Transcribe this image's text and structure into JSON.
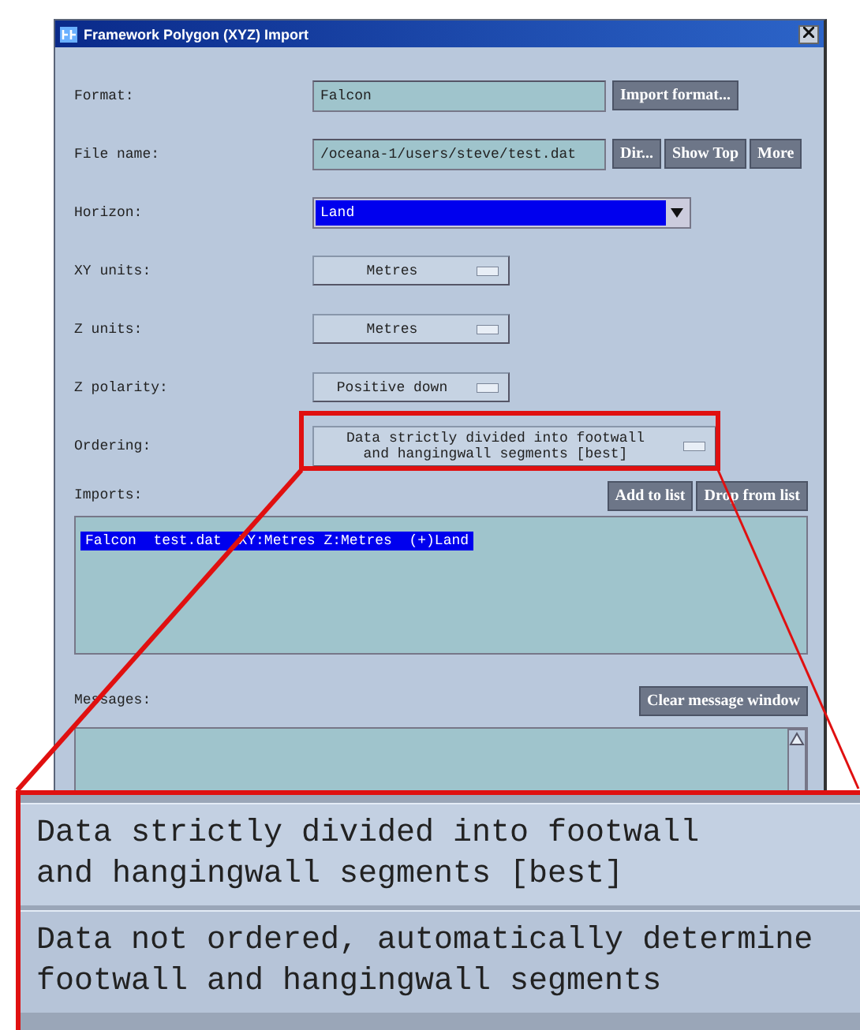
{
  "window": {
    "title": "Framework Polygon (XYZ) Import"
  },
  "fields": [
    {
      "kind": "text",
      "label": "Format:",
      "value": "Falcon",
      "buttons": [
        "Import format..."
      ]
    },
    {
      "kind": "text",
      "label": "File name:",
      "value": "/oceana-1/users/steve/test.dat",
      "buttons": [
        "Dir...",
        "Show Top",
        "More"
      ]
    },
    {
      "kind": "combo",
      "label": "Horizon:",
      "value": "Land"
    },
    {
      "kind": "option",
      "label": "XY units:",
      "value": "Metres"
    },
    {
      "kind": "option",
      "label": "Z units:",
      "value": "Metres"
    },
    {
      "kind": "option",
      "label": "Z polarity:",
      "value": "Positive down"
    },
    {
      "kind": "option",
      "label": "Ordering:",
      "value": "Data strictly divided into footwall\nand hangingwall segments [best]",
      "highlighted": true
    }
  ],
  "imports": {
    "label": "Imports:",
    "buttons": [
      "Add to list",
      "Drop from list"
    ],
    "items": [
      {
        "text": "Falcon  test.dat  XY:Metres Z:Metres  (+)Land",
        "selected": true
      }
    ]
  },
  "messages": {
    "label": "Messages:",
    "buttons": [
      "Clear message window"
    ]
  },
  "zoom_menu": {
    "options": [
      {
        "text": "Data strictly divided into footwall\nand hangingwall segments [best]",
        "selected": true
      },
      {
        "text": "Data not ordered, automatically determine\nfootwall and hangingwall segments",
        "selected": false
      }
    ]
  }
}
